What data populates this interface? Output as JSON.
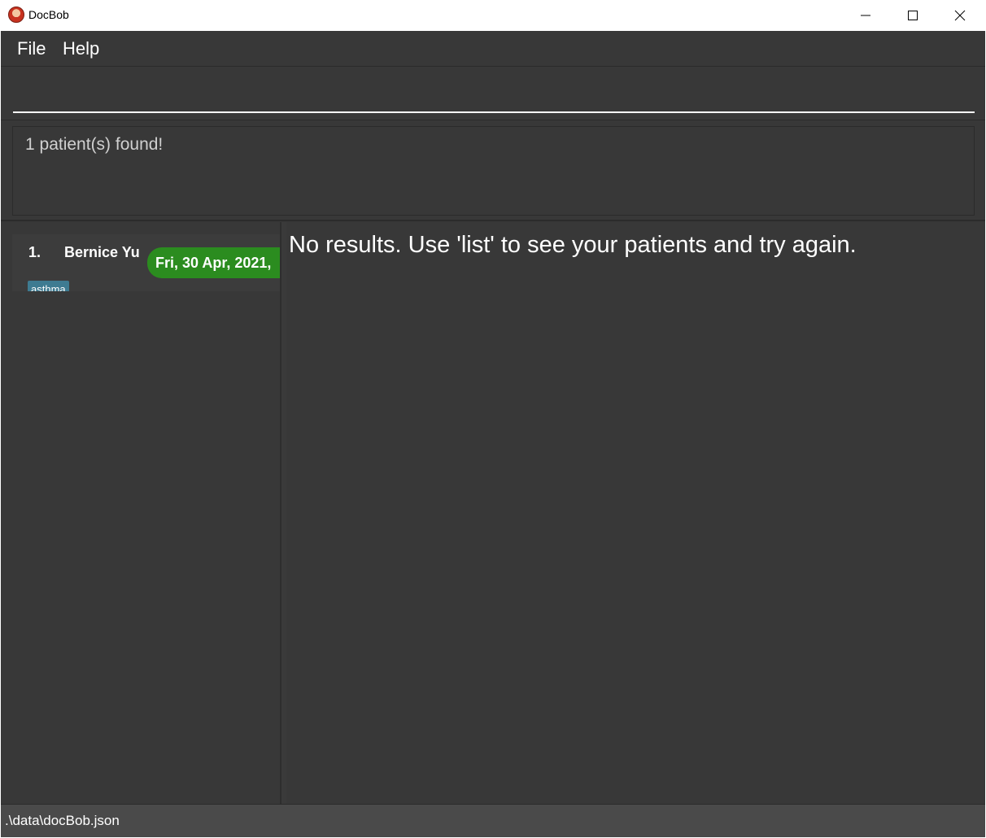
{
  "window": {
    "title": "DocBob"
  },
  "menu": {
    "file": "File",
    "help": "Help"
  },
  "command": {
    "value": ""
  },
  "result": {
    "message": "1 patient(s) found!"
  },
  "patients": [
    {
      "index": "1.",
      "name": "Bernice Yu",
      "appointment": "Fri, 30 Apr, 2021,",
      "tags": [
        "asthma"
      ]
    }
  ],
  "detail": {
    "message": "No results. Use 'list' to see your patients and try again."
  },
  "status": {
    "path": ".\\data\\docBob.json"
  },
  "colors": {
    "background": "#383838",
    "appointment_badge": "#2b8c1f",
    "tag": "#3e7b91",
    "statusbar": "#4a4a4a"
  }
}
